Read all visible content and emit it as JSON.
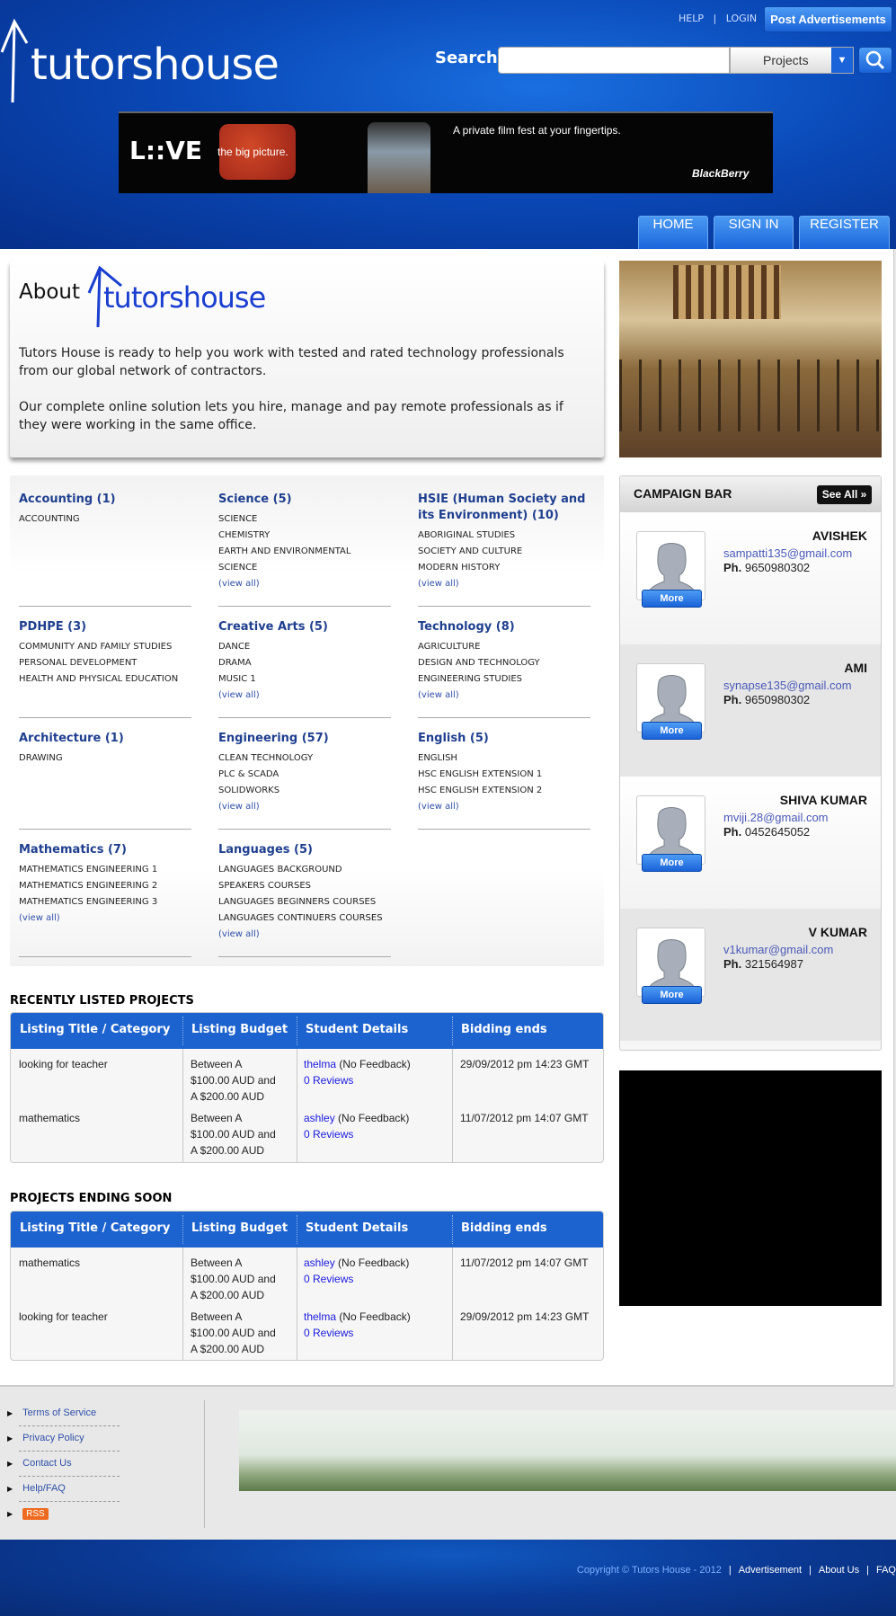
{
  "header": {
    "logo_text": "tutorshouse",
    "help": "HELP",
    "login": "LOGIN",
    "separator": "|",
    "post_ads": "Post Advertisements",
    "search_label": "Search",
    "search_value": "",
    "search_category": "Projects",
    "banner": {
      "love": "L::VE",
      "tagline": "the big picture.",
      "headline": "A private film fest at your fingertips.",
      "brand": "BlackBerry"
    },
    "nav": [
      "HOME",
      "SIGN IN",
      "REGISTER"
    ]
  },
  "about": {
    "title": "About",
    "brand": "tutorshouse",
    "p1": "Tutors House is ready to help you work with tested and rated technology professionals from our global network of contractors.",
    "p2": "Our complete online solution lets you hire, manage and pay remote professionals as if they were working in the same office."
  },
  "categories": [
    {
      "title": "Accounting (1)",
      "items": [
        "ACCOUNTING"
      ],
      "view_all": false
    },
    {
      "title": "Science (5)",
      "items": [
        "SCIENCE",
        "CHEMISTRY",
        "EARTH AND ENVIRONMENTAL",
        "SCIENCE"
      ],
      "view_all": true
    },
    {
      "title": "HSIE (Human Society and its Environment) (10)",
      "items": [
        "ABORIGINAL STUDIES",
        "SOCIETY AND CULTURE",
        "MODERN HISTORY"
      ],
      "view_all": true
    },
    {
      "title": "PDHPE (3)",
      "items": [
        "COMMUNITY AND FAMILY STUDIES",
        "PERSONAL DEVELOPMENT",
        "HEALTH AND PHYSICAL EDUCATION"
      ],
      "view_all": false
    },
    {
      "title": "Creative Arts (5)",
      "items": [
        "DANCE",
        "DRAMA",
        "MUSIC 1"
      ],
      "view_all": true
    },
    {
      "title": "Technology (8)",
      "items": [
        "AGRICULTURE",
        "DESIGN AND TECHNOLOGY",
        "ENGINEERING STUDIES"
      ],
      "view_all": true
    },
    {
      "title": "Architecture (1)",
      "items": [
        "DRAWING"
      ],
      "view_all": false
    },
    {
      "title": "Engineering (57)",
      "items": [
        "CLEAN TECHNOLOGY",
        "PLC & SCADA",
        "SOLIDWORKS"
      ],
      "view_all": true
    },
    {
      "title": "English (5)",
      "items": [
        "ENGLISH",
        "HSC ENGLISH EXTENSION 1",
        "HSC ENGLISH EXTENSION 2"
      ],
      "view_all": true
    },
    {
      "title": "Mathematics (7)",
      "items": [
        "MATHEMATICS ENGINEERING 1",
        "MATHEMATICS ENGINEERING 2",
        "MATHEMATICS ENGINEERING 3"
      ],
      "view_all": true
    },
    {
      "title": "Languages (5)",
      "items": [
        "LANGUAGES BACKGROUND",
        "SPEAKERS COURSES",
        "LANGUAGES BEGINNERS COURSES",
        "LANGUAGES CONTINUERS COURSES"
      ],
      "view_all": true
    }
  ],
  "view_all_label": "(view all)",
  "tables": [
    {
      "title": "RECENTLY LISTED PROJECTS",
      "columns": [
        "Listing Title / Category",
        "Listing Budget",
        "Student Details",
        "Bidding ends"
      ],
      "rows": [
        {
          "title": "looking for teacher",
          "budget": [
            "Between A",
            "$100.00 AUD and",
            "A $200.00 AUD"
          ],
          "student": "thelma",
          "feedback": "(No Feedback)",
          "reviews": "0 Reviews",
          "ends": "29/09/2012 pm 14:23 GMT"
        },
        {
          "title": "mathematics",
          "budget": [
            "Between A",
            "$100.00 AUD and",
            "A $200.00 AUD"
          ],
          "student": "ashley",
          "feedback": "(No Feedback)",
          "reviews": "0 Reviews",
          "ends": "11/07/2012 pm 14:07 GMT"
        }
      ]
    },
    {
      "title": "PROJECTS ENDING SOON",
      "columns": [
        "Listing Title / Category",
        "Listing Budget",
        "Student Details",
        "Bidding ends"
      ],
      "rows": [
        {
          "title": "mathematics",
          "budget": [
            "Between A",
            "$100.00 AUD and",
            "A $200.00 AUD"
          ],
          "student": "ashley",
          "feedback": "(No Feedback)",
          "reviews": "0 Reviews",
          "ends": "11/07/2012 pm 14:07 GMT"
        },
        {
          "title": "looking for teacher",
          "budget": [
            "Between A",
            "$100.00 AUD and",
            "A $200.00 AUD"
          ],
          "student": "thelma",
          "feedback": "(No Feedback)",
          "reviews": "0 Reviews",
          "ends": "29/09/2012 pm 14:23 GMT"
        }
      ]
    }
  ],
  "campaign": {
    "title": "CAMPAIGN BAR",
    "see_all": "See All »",
    "more_label": "More",
    "phone_prefix": "Ph.",
    "entries": [
      {
        "name": "AVISHEK",
        "email": "sampatti135@gmail.com",
        "phone": "9650980302"
      },
      {
        "name": "AMI",
        "email": "synapse135@gmail.com",
        "phone": "9650980302"
      },
      {
        "name": "SHIVA KUMAR",
        "email": "mviji.28@gmail.com",
        "phone": "0452645052"
      },
      {
        "name": "V KUMAR",
        "email": "v1kumar@gmail.com",
        "phone": "321564987"
      }
    ]
  },
  "footer": {
    "links": [
      "Terms of Service",
      "Privacy Policy",
      "Contact Us",
      "Help/FAQ"
    ],
    "rss": "RSS",
    "copyright": "Copyright © Tutors House - 2012",
    "bottom_links": [
      "Advertisement",
      "About Us",
      "FAQ"
    ],
    "separator": "|"
  }
}
